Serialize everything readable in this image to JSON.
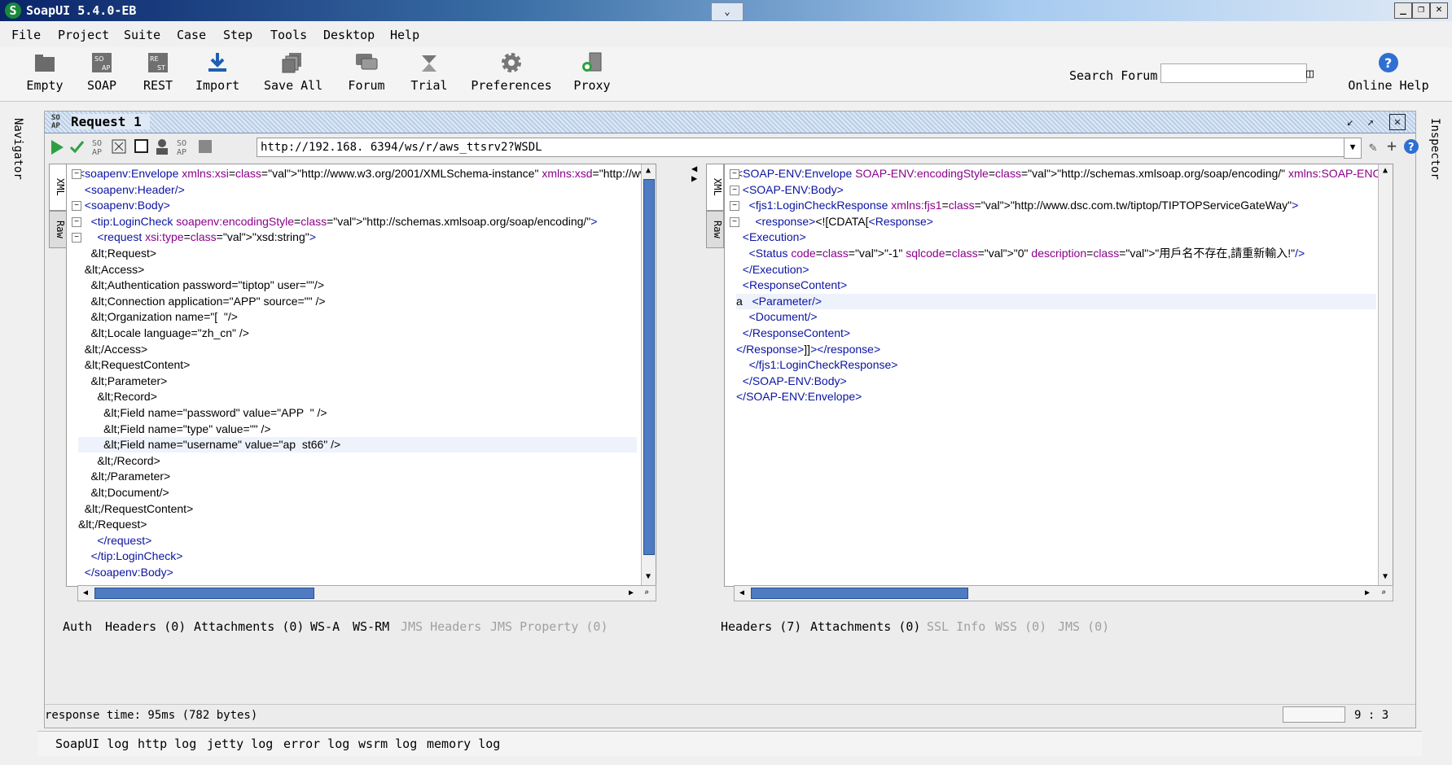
{
  "window": {
    "title": "SoapUI 5.4.0-EB"
  },
  "menu": [
    "File",
    "Project",
    "Suite",
    "Case",
    "Step",
    "Tools",
    "Desktop",
    "Help"
  ],
  "toolbar": {
    "buttons": [
      "Empty",
      "SOAP",
      "REST",
      "Import",
      "Save All",
      "Forum",
      "Trial",
      "Preferences",
      "Proxy"
    ],
    "search_label": "Search Forum",
    "search_value": "",
    "online_help": "Online Help"
  },
  "side": {
    "left": "Navigator",
    "right": "Inspector"
  },
  "request": {
    "title": "Request 1",
    "url": "http://192.168.  6394/ws/r/aws_ttsrv2?WSDL",
    "editor_tabs": {
      "xml": "XML",
      "raw": "Raw"
    }
  },
  "request_xml": [
    "<soapenv:Envelope xmlns:xsi=\"http://www.w3.org/2001/XMLSchema-instance\" xmlns:xsd=\"http://www.w",
    "  <soapenv:Header/>",
    "  <soapenv:Body>",
    "    <tip:LoginCheck soapenv:encodingStyle=\"http://schemas.xmlsoap.org/soap/encoding/\">",
    "      <request xsi:type=\"xsd:string\">",
    "    &lt;Request>",
    "  &lt;Access>",
    "    &lt;Authentication password=\"tiptop\" user=\"\"/>",
    "    &lt;Connection application=\"APP\" source=\"\" />",
    "    &lt;Organization name=\"[  \"/>",
    "    &lt;Locale language=\"zh_cn\" />",
    "  &lt;/Access>",
    "  &lt;RequestContent>",
    "    &lt;Parameter>",
    "      &lt;Record>",
    "        &lt;Field name=\"password\" value=\"APP  \" />",
    "        &lt;Field name=\"type\" value=\"\" />",
    "        &lt;Field name=\"username\" value=\"ap  st66\" />",
    "      &lt;/Record>",
    "    &lt;/Parameter>",
    "    &lt;Document/>",
    "  &lt;/RequestContent>",
    "&lt;/Request>",
    "      </request>",
    "    </tip:LoginCheck>",
    "  </soapenv:Body>"
  ],
  "response_xml": [
    "<SOAP-ENV:Envelope SOAP-ENV:encodingStyle=\"http://schemas.xmlsoap.org/soap/encoding/\" xmlns:SOAP-ENC=\"http",
    "  <SOAP-ENV:Body>",
    "    <fjs1:LoginCheckResponse xmlns:fjs1=\"http://www.dsc.com.tw/tiptop/TIPTOPServiceGateWay\">",
    "      <response><![CDATA[<Response>",
    "  <Execution>",
    "    <Status code=\"-1\" sqlcode=\"0\" description=\"用戶名不存在,請重新輸入!\"/>",
    "  </Execution>",
    "  <ResponseContent>",
    "a   <Parameter/>",
    "    <Document/>",
    "  </ResponseContent>",
    "</Response>]]></response>",
    "    </fjs1:LoginCheckResponse>",
    "  </SOAP-ENV:Body>",
    "</SOAP-ENV:Envelope>"
  ],
  "req_tabs": [
    "Auth",
    "Headers (0)",
    "Attachments (0)",
    "WS-A",
    "WS-RM",
    "JMS Headers",
    "JMS Property (0)"
  ],
  "resp_tabs": [
    "Headers (7)",
    "Attachments (0)",
    "SSL Info",
    "WSS (0)",
    "JMS (0)"
  ],
  "status": {
    "response_time": "response time: 95ms (782 bytes)",
    "position": "9 : 3"
  },
  "log_tabs": [
    "SoapUI log",
    "http log",
    "jetty log",
    "error log",
    "wsrm log",
    "memory log"
  ]
}
